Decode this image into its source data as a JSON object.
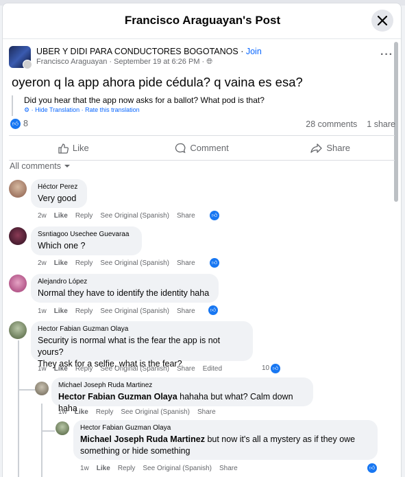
{
  "header": {
    "title": "Francisco Araguayan's Post"
  },
  "post": {
    "group_name": "UBER Y DIDI PARA CONDUCTORES BOGOTANOS",
    "join_label": "Join",
    "author": "Francisco Araguayan",
    "date": "September 19 at 6:26 PM",
    "text": "oyeron q la app ahora pide cédula? q vaina es esa?",
    "translation": "Did you hear that the app now asks for a ballot? What pod is that?",
    "translation_links": "· Hide Translation · Rate this translation",
    "reaction_count": "8",
    "comments_count": "28 comments",
    "shares_count": "1 share"
  },
  "actions": {
    "like": "Like",
    "comment": "Comment",
    "share": "Share"
  },
  "sort_label": "All comments",
  "comments": [
    {
      "author": "Héctor Perez",
      "text": "Very good",
      "time": "2w",
      "like": "Like",
      "reply": "Reply",
      "see_original": "See Original (Spanish)",
      "share": "Share"
    },
    {
      "author": "Ssntiagoo Usechee Guevaraa",
      "text": "Which one ?",
      "time": "2w",
      "like": "Like",
      "reply": "Reply",
      "see_original": "See Original (Spanish)",
      "share": "Share"
    },
    {
      "author": "Alejandro López",
      "text": "Normal they have to identify the identity haha",
      "time": "1w",
      "like": "Like",
      "reply": "Reply",
      "see_original": "See Original (Spanish)",
      "share": "Share"
    },
    {
      "author": "Hector Fabian Guzman Olaya",
      "text1": "Security is normal what is the fear the app is not yours?",
      "text2": "They ask for a selfie, what is the fear?",
      "time": "1w",
      "like": "Like",
      "reply": "Reply",
      "see_original": "See Original (Spanish)",
      "share": "Share",
      "edited": "Edited",
      "likes": "10"
    },
    {
      "author": "Michael Joseph Ruda Martinez",
      "mention": "Hector Fabian Guzman Olaya",
      "text": " hahaha but what? Calm down haha",
      "time": "1w",
      "like": "Like",
      "reply": "Reply",
      "see_original": "See Original (Spanish)",
      "share": "Share"
    },
    {
      "author": "Hector Fabian Guzman Olaya",
      "mention": "Michael Joseph Ruda Martinez",
      "text1": " but now it's all a mystery as if they owe",
      "text2": "something or hide something",
      "time": "1w",
      "like": "Like",
      "reply": "Reply",
      "see_original": "See Original (Spanish)",
      "share": "Share"
    }
  ],
  "colors": {
    "accent": "#1877f2",
    "link": "#0866ff",
    "muted": "#65676b",
    "bubble": "#f0f2f5"
  }
}
